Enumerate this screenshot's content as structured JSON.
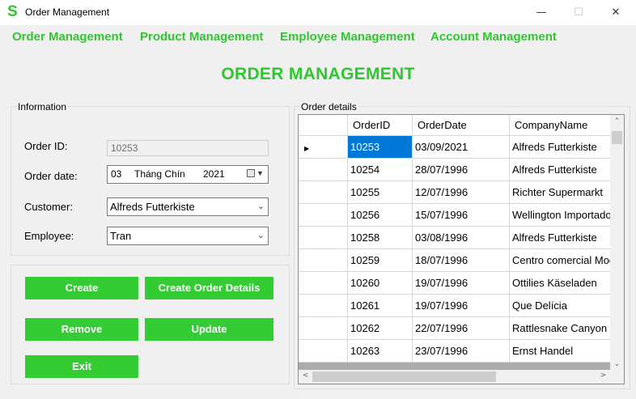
{
  "window": {
    "title": "Order Management",
    "app_letter": "S",
    "minimize": "—",
    "maximize": "☐",
    "close": "✕"
  },
  "menu": [
    {
      "label": "Order Management"
    },
    {
      "label": "Product Management"
    },
    {
      "label": "Employee Management"
    },
    {
      "label": "Account Management"
    }
  ],
  "page_title": "ORDER MANAGEMENT",
  "info": {
    "legend": "Information",
    "order_id_label": "Order ID:",
    "order_id_value": "10253",
    "order_date_label": "Order date:",
    "order_date_day": "03",
    "order_date_month": "Tháng Chín",
    "order_date_year": "2021",
    "customer_label": "Customer:",
    "customer_value": "Alfreds Futterkiste",
    "employee_label": "Employee:",
    "employee_value": "Tran"
  },
  "actions": {
    "create": "Create",
    "create_details": "Create Order Details",
    "remove": "Remove",
    "update": "Update",
    "exit": "Exit"
  },
  "grid": {
    "legend": "Order details",
    "columns": [
      "OrderID",
      "OrderDate",
      "CompanyName"
    ],
    "rows": [
      [
        "10253",
        "03/09/2021",
        "Alfreds Futterkiste"
      ],
      [
        "10254",
        "28/07/1996",
        "Alfreds Futterkiste"
      ],
      [
        "10255",
        "12/07/1996",
        "Richter Supermarkt"
      ],
      [
        "10256",
        "15/07/1996",
        "Wellington Importadora"
      ],
      [
        "10258",
        "03/08/1996",
        "Alfreds Futterkiste"
      ],
      [
        "10259",
        "18/07/1996",
        "Centro comercial Moctezuma"
      ],
      [
        "10260",
        "19/07/1996",
        "Ottilies Käseladen"
      ],
      [
        "10261",
        "19/07/1996",
        "Que Delícia"
      ],
      [
        "10262",
        "22/07/1996",
        "Rattlesnake Canyon Grocery"
      ],
      [
        "10263",
        "23/07/1996",
        "Ernst Handel"
      ]
    ],
    "selected_row": 0
  },
  "colors": {
    "accent": "#33cc33",
    "selection": "#0078d7"
  }
}
